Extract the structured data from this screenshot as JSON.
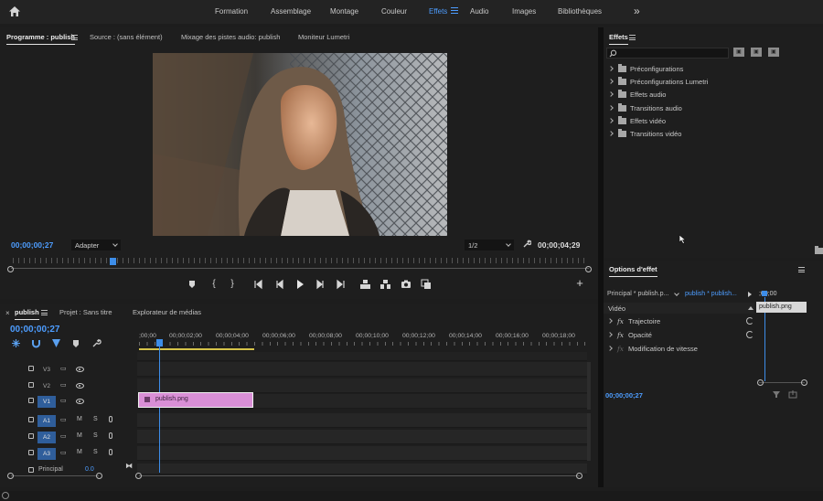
{
  "workspace": {
    "tabs": [
      "Formation",
      "Assemblage",
      "Montage",
      "Couleur",
      "Effets",
      "Audio",
      "Images",
      "Bibliothèques"
    ],
    "active": "Effets",
    "more": "»"
  },
  "program": {
    "tabs": [
      "Programme : publish",
      "Source : (sans élément)",
      "Mixage des pistes audio: publish",
      "Moniteur Lumetri"
    ],
    "timecode_current": "00;00;00;27",
    "fit": "Adapter",
    "resolution": "1/2",
    "timecode_duration": "00;00;04;29",
    "controls": [
      "marker",
      "in",
      "out",
      "go-to-in",
      "step-back",
      "play",
      "step-forward",
      "go-to-out",
      "lift",
      "extract",
      "export-frame",
      "compare",
      "add"
    ]
  },
  "effects": {
    "title": "Effets",
    "folders": [
      "Préconfigurations",
      "Préconfigurations Lumetri",
      "Effets audio",
      "Transitions audio",
      "Effets vidéo",
      "Transitions vidéo"
    ]
  },
  "effect_options": {
    "title": "Options d'effet",
    "source_label": "Principal * publish.p...",
    "seq_label": "publish * publish...",
    "mini_timecode": ";00;00",
    "clip_chip": "publish.png",
    "section": "Vidéo",
    "properties": [
      "Trajectoire",
      "Opacité",
      "Modification de vitesse"
    ],
    "timecode": "00;00;00;27"
  },
  "timeline": {
    "tabs": [
      "publish",
      "Projet : Sans titre",
      "Explorateur de médias"
    ],
    "timecode": "00;00;00;27",
    "ruler": [
      ";00;00",
      "00;00;02;00",
      "00;00;04;00",
      "00;00;06;00",
      "00;00;08;00",
      "00;00;10;00",
      "00;00;12;00",
      "00;00;14;00",
      "00;00;16;00",
      "00;00;18;00"
    ],
    "video_tracks": [
      "V3",
      "V2",
      "V1"
    ],
    "audio_tracks": [
      "A1",
      "A2",
      "A3"
    ],
    "track_m": "M",
    "track_s": "S",
    "master_label": "Principal",
    "master_value": "0.0",
    "clip_name": "publish.png"
  },
  "colors": {
    "accent": "#4d9dff",
    "clip": "#d98fd6",
    "work_area": "#d6c34a"
  }
}
